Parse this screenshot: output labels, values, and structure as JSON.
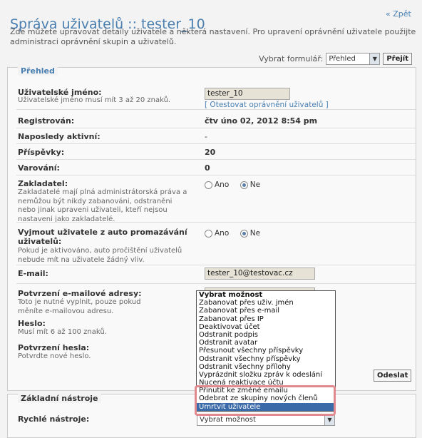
{
  "header": {
    "title": "Správa uživatelů :: tester_10",
    "back_link": "« Zpět",
    "intro": "Zde můžete upravovat detaily uživatele a některá nastavení. Pro upravení oprávnění uživatele použijte administraci oprávnění skupin a uživatelů."
  },
  "form_select": {
    "label": "Vybrat formulář:",
    "selected": "Přehled",
    "go_button": "Přejít"
  },
  "overview": {
    "legend": "Přehled",
    "username": {
      "label": "Uživatelské jméno:",
      "desc": "Uživatelské jméno musí mít 3 až 20 znaků.",
      "value": "tester_10",
      "perm_link": "[ Otestovat oprávnění uživatelů ]"
    },
    "registered": {
      "label": "Registrován:",
      "value": "čtv úno 02, 2012 8:54 pm"
    },
    "last_active": {
      "label": "Naposledy aktivní:",
      "value": "-"
    },
    "posts": {
      "label": "Příspěvky:",
      "value": "20"
    },
    "warnings": {
      "label": "Varování:",
      "value": "0"
    },
    "founder": {
      "label": "Zakladatel:",
      "desc": "Zakladatelé mají plná administrátorská práva a nemůžou být nikdy zabanováni, odstraněni nebo jinak upraveni uživateli, kteří nejsou nastaveni jako zakladatelé.",
      "yes": "Ano",
      "no": "Ne"
    },
    "prune": {
      "label": "Vyjmout uživatele z auto promazávání uživatelů:",
      "desc": "Pokud je aktivováno, auto pročištění uživatelů nebude mít na uživatele žádný vliv.",
      "yes": "Ano",
      "no": "Ne"
    },
    "email": {
      "label": "E-mail:",
      "value": "tester_10@testovac.cz"
    },
    "email_confirm": {
      "label": "Potvrzení e-mailové adresy:",
      "desc": "Toto je nutné vyplnit, pouze pokud měníte e-mailovou adresu."
    },
    "password": {
      "label": "Heslo:",
      "desc": "Musí mít 6 až 100 znaků."
    },
    "password_confirm": {
      "label": "Potvrzení hesla:",
      "desc": "Potvrdte nové heslo."
    },
    "submit": "Odeslat"
  },
  "tools": {
    "legend": "Základní nástroje",
    "quick_label": "Rychlé nástroje:",
    "selected": "Vybrat možnost",
    "options": [
      "Vybrat možnost",
      "Zabanovat přes uživ. jmén",
      "Zabanovat přes e-mail",
      "Zabanovat přes IP",
      "Deaktivovat účet",
      "Odstranit podpis",
      "Odstranit avatar",
      "Přesunout všechny příspěvky",
      "Odstranit všechny příspěvky",
      "Odstranit všechny přílohy",
      "Vyprázdnit složku zpráv k odeslání",
      "Nucená reaktivace účtu",
      "Přinutit ke změně emailu",
      "Odebrat ze skupiny nových členů",
      "Umrtvit uživatele"
    ],
    "highlighted_index": 14
  },
  "colors": {
    "title": "#4a7fb0",
    "highlight": "#3a6aa8",
    "callout": "#e08a90"
  }
}
